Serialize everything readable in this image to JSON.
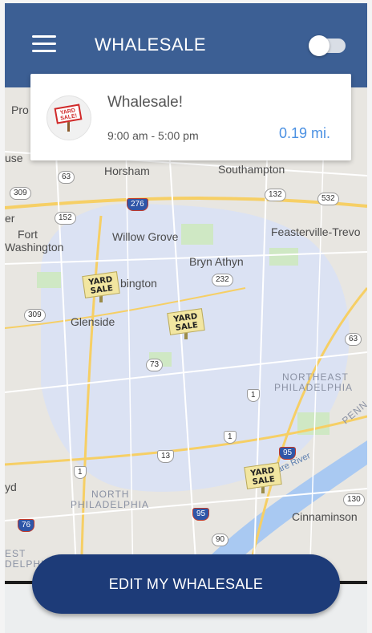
{
  "app_bar": {
    "title": "WHALESALE",
    "menu_icon": "hamburger-menu-icon",
    "toggle_state": "off"
  },
  "sale_card": {
    "logo_icon": "yard-sale-sign-icon",
    "logo_text_line1": "YARD",
    "logo_text_line2": "SALE!",
    "title": "Whalesale!",
    "hours": "9:00 am - 5:00 pm",
    "distance": "0.19 mi."
  },
  "map": {
    "places": [
      {
        "name": "Horsham"
      },
      {
        "name": "Southampton"
      },
      {
        "name": "Fort"
      },
      {
        "name": "Washington"
      },
      {
        "name": "Willow Grove"
      },
      {
        "name": "Feasterville-Trevo"
      },
      {
        "name": "Bryn Athyn"
      },
      {
        "name": "Glenside"
      },
      {
        "name": "NORTHEAST"
      },
      {
        "name": "PHILADELPHIA"
      },
      {
        "name": "NORTH"
      },
      {
        "name": "PHILADELPHIA"
      },
      {
        "name": "Cinnaminson"
      },
      {
        "name": "bington"
      },
      {
        "name": "Pro"
      },
      {
        "name": "use"
      },
      {
        "name": "er"
      },
      {
        "name": "yd"
      },
      {
        "name": "EST"
      },
      {
        "name": "DELPHIA"
      },
      {
        "name": "PENN"
      },
      {
        "name": "are River"
      }
    ],
    "shields": [
      "63",
      "309",
      "152",
      "276",
      "132",
      "532",
      "232",
      "309",
      "73",
      "1",
      "1",
      "13",
      "95",
      "1",
      "63",
      "76",
      "95",
      "90",
      "130"
    ],
    "pin_label_line1": "YARD",
    "pin_label_line2": "SALE"
  },
  "colors": {
    "app_bar": "#3c5f94",
    "button": "#1d3b78",
    "distance": "#4a90e2",
    "highlight_area": "#d9e1f5"
  },
  "edit_button": {
    "label": "EDIT MY WHALESALE"
  }
}
